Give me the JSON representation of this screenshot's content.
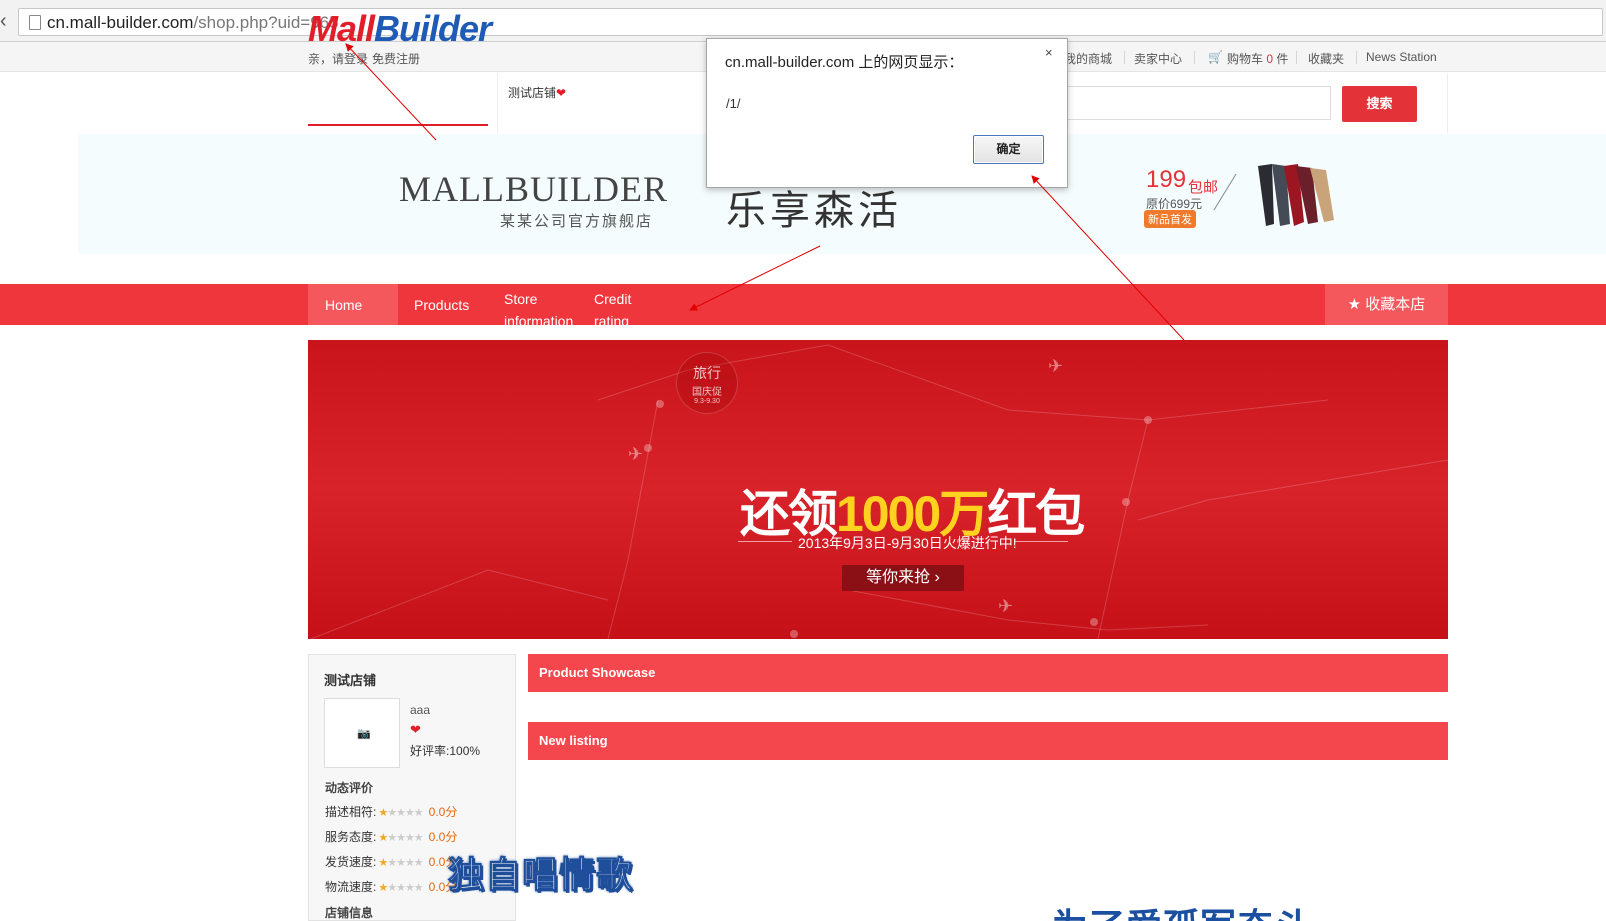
{
  "browser": {
    "url_domain": "cn.mall-builder.com",
    "url_path": "/shop.php?uid=965"
  },
  "topbar": {
    "greeting": "亲，请登录",
    "register": "免费注册",
    "my_mall": "我的商城",
    "seller_center": "卖家中心",
    "cart_label": "购物车",
    "cart_count": "0",
    "cart_unit": "件",
    "favorites": "收藏夹",
    "news": "News Station"
  },
  "header": {
    "logo_mall": "Mall",
    "logo_builder": "Builder",
    "shop_name": "测试店铺",
    "search_button": "搜索",
    "search_value": ""
  },
  "shop_banner": {
    "brand": "MALLBUILDER",
    "subtitle": "某某公司官方旗舰店",
    "slogan": "乐享森活",
    "promo_price": "199",
    "promo_free": "包邮",
    "promo_original": "原价699元",
    "promo_new": "新品首发"
  },
  "nav": {
    "items": [
      "Home",
      "Products",
      "Store information",
      "Credit rating"
    ],
    "favorite": "收藏本店"
  },
  "promo": {
    "badge_line1": "旅行",
    "badge_line2": "国庆促",
    "badge_line3": "9.3-9.30",
    "title_a": "还领",
    "title_num": "1000万",
    "title_b": "红包",
    "date": "2013年9月3日-9月30日火爆进行中!",
    "cta": "等你来抢 ›"
  },
  "sidebar": {
    "title": "测试店铺",
    "seller": "aaa",
    "good_rate_label": "好评率:",
    "good_rate": "100%",
    "dynamic_title": "动态评价",
    "ratings": [
      {
        "label": "描述相符:",
        "score": "0.0分"
      },
      {
        "label": "服务态度:",
        "score": "0.0分"
      },
      {
        "label": "发货速度:",
        "score": "0.0分"
      },
      {
        "label": "物流速度:",
        "score": "0.0分"
      }
    ],
    "store_info": "店铺信息"
  },
  "sections": {
    "showcase": "Product Showcase",
    "new_listing": "New listing"
  },
  "dialog": {
    "title": "cn.mall-builder.com 上的网页显示：",
    "message": "/1/",
    "ok": "确定",
    "close": "×"
  },
  "overlay": {
    "caption": "独自唱情歌",
    "caption_2": "为了爱孤军奋斗"
  },
  "colors": {
    "brand_red": "#f0363d",
    "section_red": "#f3464d",
    "promo_red": "#d9232b"
  }
}
